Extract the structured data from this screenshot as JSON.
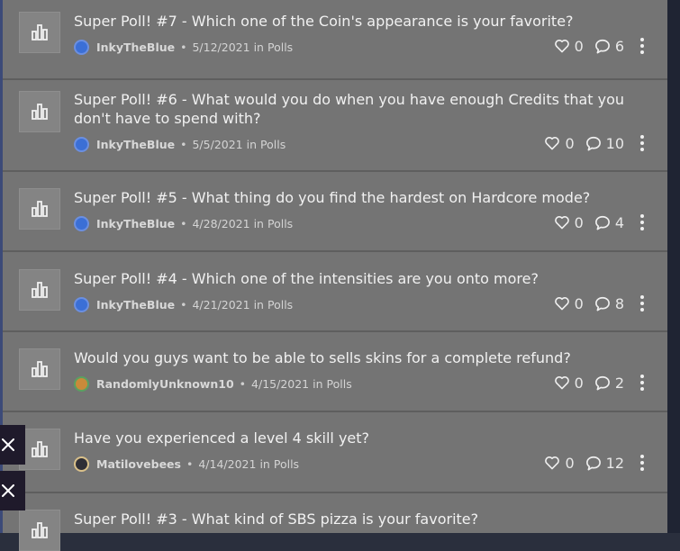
{
  "posts": [
    {
      "title": "Super Poll! #7 - Which one of the Coin's appearance is your favorite?",
      "author": "InkyTheBlue",
      "date": "5/12/2021",
      "in": "in",
      "category": "Polls",
      "likes": "0",
      "comments": "6",
      "avatar": "blue"
    },
    {
      "title": "Super Poll! #6 - What would you do when you have enough Credits that you don't have to spend with?",
      "author": "InkyTheBlue",
      "date": "5/5/2021",
      "in": "in",
      "category": "Polls",
      "likes": "0",
      "comments": "10",
      "avatar": "blue"
    },
    {
      "title": "Super Poll! #5 - What thing do you find the hardest on Hardcore mode?",
      "author": "InkyTheBlue",
      "date": "4/28/2021",
      "in": "in",
      "category": "Polls",
      "likes": "0",
      "comments": "4",
      "avatar": "blue"
    },
    {
      "title": "Super Poll! #4 - Which one of the intensities are you onto more?",
      "author": "InkyTheBlue",
      "date": "4/21/2021",
      "in": "in",
      "category": "Polls",
      "likes": "0",
      "comments": "8",
      "avatar": "blue"
    },
    {
      "title": "Would you guys want to be able to sells skins for a complete refund?",
      "author": "RandomlyUnknown10",
      "date": "4/15/2021",
      "in": "in",
      "category": "Polls",
      "likes": "0",
      "comments": "2",
      "avatar": "orange"
    },
    {
      "title": "Have you experienced a level 4 skill yet?",
      "author": "Matilovebees",
      "date": "4/14/2021",
      "in": "in",
      "category": "Polls",
      "likes": "0",
      "comments": "12",
      "avatar": "dark"
    },
    {
      "title": "Super Poll! #3 - What kind of SBS pizza is your favorite?",
      "author": "",
      "date": "",
      "in": "",
      "category": "",
      "likes": "",
      "comments": "",
      "avatar": ""
    }
  ],
  "icons": {
    "post": "poll-chart-icon",
    "like": "heart-icon",
    "comment": "comment-icon",
    "more": "kebab-menu-icon",
    "close": "close-icon"
  },
  "colors": {
    "card": "#747474",
    "divider": "#5e5e5e",
    "text": "#f1f1f1",
    "overlay": "#1f1a2b"
  }
}
